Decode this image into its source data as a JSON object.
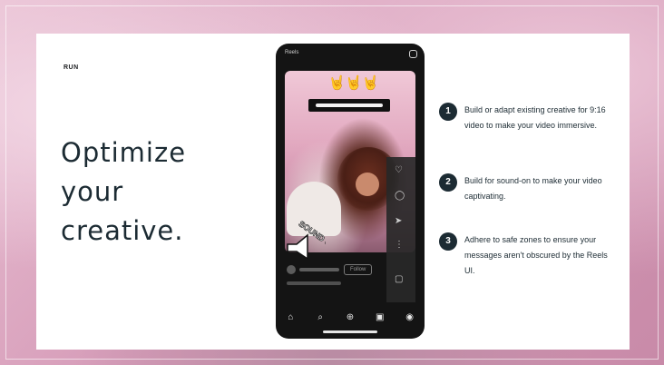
{
  "slide": {
    "section_label": "RUN",
    "headline_lines": [
      "Optimize",
      "your",
      "creative."
    ]
  },
  "phone": {
    "top_label": "Reels",
    "emoji": "🤘🤘🤘",
    "sound_on_label": "SOUND ON",
    "follow_label": "Follow",
    "nav_icons": [
      "home-icon",
      "search-icon",
      "create-icon",
      "reels-icon",
      "profile-icon"
    ],
    "side_icons": [
      "heart-icon",
      "comment-icon",
      "share-icon",
      "more-icon",
      "audio-icon"
    ]
  },
  "steps": [
    {
      "number": "1",
      "text": "Build or adapt existing creative for 9:16 video to make your video immersive."
    },
    {
      "number": "2",
      "text": "Build for sound-on to make your video captivating."
    },
    {
      "number": "3",
      "text": "Adhere to safe zones to ensure your messages aren't obscured by the Reels UI."
    }
  ],
  "colors": {
    "text_dark": "#1c2b33",
    "card": "#ffffff",
    "phone": "#141414",
    "background_pink": "#d8a9c1"
  }
}
